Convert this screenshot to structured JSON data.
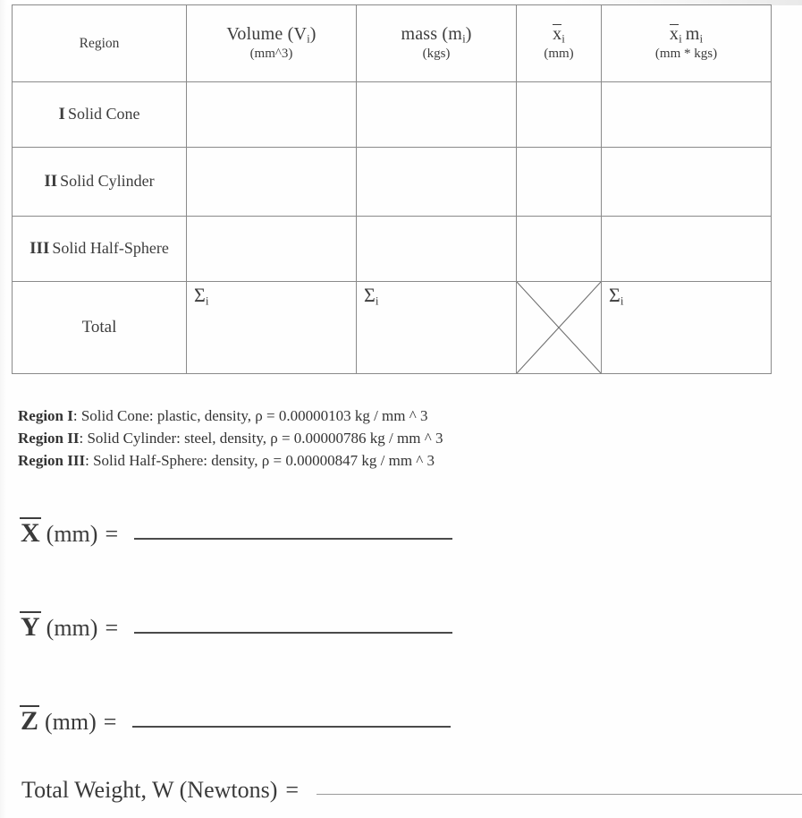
{
  "table": {
    "headers": [
      {
        "title": "Region",
        "sub": ""
      },
      {
        "title": "Volume  (V",
        "sub": "(mm^3)"
      },
      {
        "title": "mass (m",
        "sub": "(kgs)"
      },
      {
        "title": "x",
        "sub": "(mm)"
      },
      {
        "title": "x",
        "sub": "(mm * kgs)"
      }
    ],
    "header_region": "Region",
    "header_volume_main": "Volume  (V",
    "header_volume_close": ")",
    "header_volume_sub": "(mm^3)",
    "header_mass_main": "mass (m",
    "header_mass_close": ")",
    "header_mass_sub": "(kgs)",
    "header_xbar_main": "x",
    "header_xbar_sub": "(mm)",
    "header_xm_x": "x",
    "header_xm_m": "m",
    "header_xm_sub": "(mm * kgs)",
    "sub_i": "i",
    "rows": [
      {
        "numeral": "I",
        "label": "Solid Cone",
        "volume": "",
        "mass": "",
        "xbar": "",
        "xm": ""
      },
      {
        "numeral": "II",
        "label": "Solid Cylinder",
        "volume": "",
        "mass": "",
        "xbar": "",
        "xm": ""
      },
      {
        "numeral": "III",
        "label": "Solid Half-Sphere",
        "volume": "",
        "mass": "",
        "xbar": "",
        "xm": ""
      }
    ],
    "total": {
      "label": "Total",
      "volume_sum": "Σ",
      "mass_sum": "Σ",
      "xm_sum": "Σ",
      "sum_sub": "i",
      "xbar_cell": "crossed-out"
    }
  },
  "notes": [
    {
      "bold": "Region I",
      "text": ": Solid Cone: plastic, density, ",
      "rho": "ρ",
      "value": " = 0.00000103 kg / mm ^ 3"
    },
    {
      "bold": "Region II",
      "text": ": Solid Cylinder: steel, density, ",
      "rho": "ρ",
      "value": " = 0.00000786 kg / mm ^ 3"
    },
    {
      "bold": "Region III",
      "text": ": Solid Half-Sphere: density, ",
      "rho": "ρ",
      "value": " = 0.00000847 kg / mm ^ 3"
    }
  ],
  "answers": [
    {
      "var": "X",
      "unit": "(mm)",
      "eq": "=",
      "value": ""
    },
    {
      "var": "Y",
      "unit": "(mm)",
      "eq": "=",
      "value": ""
    },
    {
      "var": "Z",
      "unit": "(mm)",
      "eq": "=",
      "value": ""
    }
  ],
  "total_weight": {
    "label": "Total Weight, W (Newtons)",
    "eq": "=",
    "value": ""
  },
  "colors": {
    "ink": "#3a3a3a",
    "rule": "#8a8a8a",
    "page": "#fefefe"
  }
}
